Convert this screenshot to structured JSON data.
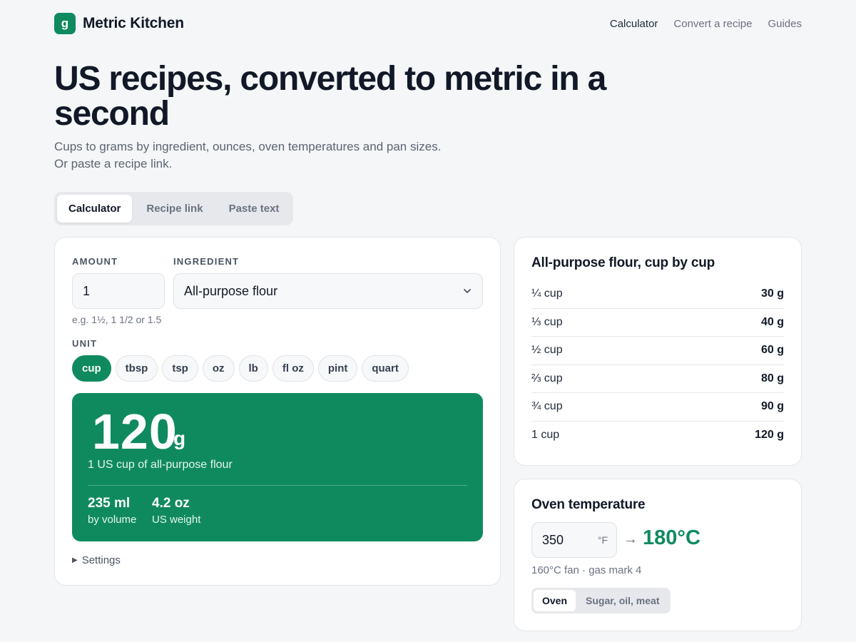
{
  "brand": {
    "logo_letter": "g",
    "name": "Metric Kitchen"
  },
  "nav": {
    "items": [
      "Calculator",
      "Convert a recipe",
      "Guides"
    ],
    "active": "Calculator"
  },
  "hero": {
    "title": "US recipes, converted to metric in a second",
    "subtitle_line1": "Cups to grams by ingredient, ounces, oven temperatures and pan sizes.",
    "subtitle_line2": "Or paste a recipe link."
  },
  "mode_tabs": {
    "items": [
      "Calculator",
      "Recipe link",
      "Paste text"
    ],
    "active": "Calculator"
  },
  "calculator": {
    "amount_label": "AMOUNT",
    "amount_value": "1",
    "amount_hint": "e.g. 1½, 1 1/2 or 1.5",
    "ingredient_label": "INGREDIENT",
    "ingredient_value": "All-purpose flour",
    "unit_label": "UNIT",
    "units": [
      "cup",
      "tbsp",
      "tsp",
      "oz",
      "lb",
      "fl oz",
      "pint",
      "quart"
    ],
    "active_unit": "cup",
    "result": {
      "value": "120",
      "unit": "g",
      "description": "1 US cup of all-purpose flour",
      "volume_value": "235 ml",
      "volume_label": "by volume",
      "weight_value": "4.2 oz",
      "weight_label": "US weight"
    },
    "settings_label": "Settings"
  },
  "flour_table": {
    "title": "All-purpose flour, cup by cup",
    "rows": [
      {
        "amount": "¼ cup",
        "grams": "30 g"
      },
      {
        "amount": "⅓ cup",
        "grams": "40 g"
      },
      {
        "amount": "½ cup",
        "grams": "60 g"
      },
      {
        "amount": "⅔ cup",
        "grams": "80 g"
      },
      {
        "amount": "¾ cup",
        "grams": "90 g"
      },
      {
        "amount": "1 cup",
        "grams": "120 g"
      }
    ]
  },
  "oven": {
    "title": "Oven temperature",
    "input_value": "350",
    "input_unit": "°F",
    "arrow": "→",
    "result": "180°C",
    "note": "160°C fan · gas mark 4",
    "tabs": [
      "Oven",
      "Sugar, oil, meat"
    ],
    "active_tab": "Oven"
  },
  "colors": {
    "accent": "#0f8a5f",
    "background": "#f5f6f8"
  },
  "icons": {
    "dropdown": "chevron-down-icon",
    "settings_toggle": "triangle-right-icon",
    "convert": "arrow-right-icon"
  }
}
